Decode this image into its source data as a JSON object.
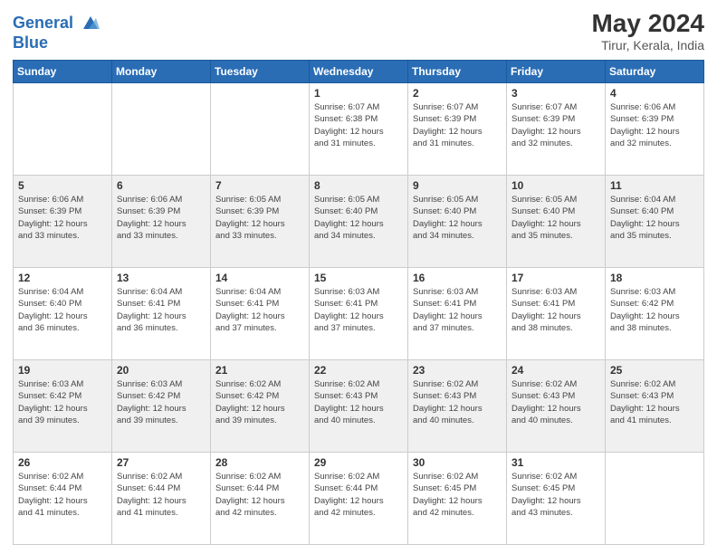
{
  "header": {
    "logo_line1": "General",
    "logo_line2": "Blue",
    "month_year": "May 2024",
    "location": "Tirur, Kerala, India"
  },
  "days_of_week": [
    "Sunday",
    "Monday",
    "Tuesday",
    "Wednesday",
    "Thursday",
    "Friday",
    "Saturday"
  ],
  "weeks": [
    [
      {
        "day": "",
        "info": ""
      },
      {
        "day": "",
        "info": ""
      },
      {
        "day": "",
        "info": ""
      },
      {
        "day": "1",
        "info": "Sunrise: 6:07 AM\nSunset: 6:38 PM\nDaylight: 12 hours\nand 31 minutes."
      },
      {
        "day": "2",
        "info": "Sunrise: 6:07 AM\nSunset: 6:39 PM\nDaylight: 12 hours\nand 31 minutes."
      },
      {
        "day": "3",
        "info": "Sunrise: 6:07 AM\nSunset: 6:39 PM\nDaylight: 12 hours\nand 32 minutes."
      },
      {
        "day": "4",
        "info": "Sunrise: 6:06 AM\nSunset: 6:39 PM\nDaylight: 12 hours\nand 32 minutes."
      }
    ],
    [
      {
        "day": "5",
        "info": "Sunrise: 6:06 AM\nSunset: 6:39 PM\nDaylight: 12 hours\nand 33 minutes."
      },
      {
        "day": "6",
        "info": "Sunrise: 6:06 AM\nSunset: 6:39 PM\nDaylight: 12 hours\nand 33 minutes."
      },
      {
        "day": "7",
        "info": "Sunrise: 6:05 AM\nSunset: 6:39 PM\nDaylight: 12 hours\nand 33 minutes."
      },
      {
        "day": "8",
        "info": "Sunrise: 6:05 AM\nSunset: 6:40 PM\nDaylight: 12 hours\nand 34 minutes."
      },
      {
        "day": "9",
        "info": "Sunrise: 6:05 AM\nSunset: 6:40 PM\nDaylight: 12 hours\nand 34 minutes."
      },
      {
        "day": "10",
        "info": "Sunrise: 6:05 AM\nSunset: 6:40 PM\nDaylight: 12 hours\nand 35 minutes."
      },
      {
        "day": "11",
        "info": "Sunrise: 6:04 AM\nSunset: 6:40 PM\nDaylight: 12 hours\nand 35 minutes."
      }
    ],
    [
      {
        "day": "12",
        "info": "Sunrise: 6:04 AM\nSunset: 6:40 PM\nDaylight: 12 hours\nand 36 minutes."
      },
      {
        "day": "13",
        "info": "Sunrise: 6:04 AM\nSunset: 6:41 PM\nDaylight: 12 hours\nand 36 minutes."
      },
      {
        "day": "14",
        "info": "Sunrise: 6:04 AM\nSunset: 6:41 PM\nDaylight: 12 hours\nand 37 minutes."
      },
      {
        "day": "15",
        "info": "Sunrise: 6:03 AM\nSunset: 6:41 PM\nDaylight: 12 hours\nand 37 minutes."
      },
      {
        "day": "16",
        "info": "Sunrise: 6:03 AM\nSunset: 6:41 PM\nDaylight: 12 hours\nand 37 minutes."
      },
      {
        "day": "17",
        "info": "Sunrise: 6:03 AM\nSunset: 6:41 PM\nDaylight: 12 hours\nand 38 minutes."
      },
      {
        "day": "18",
        "info": "Sunrise: 6:03 AM\nSunset: 6:42 PM\nDaylight: 12 hours\nand 38 minutes."
      }
    ],
    [
      {
        "day": "19",
        "info": "Sunrise: 6:03 AM\nSunset: 6:42 PM\nDaylight: 12 hours\nand 39 minutes."
      },
      {
        "day": "20",
        "info": "Sunrise: 6:03 AM\nSunset: 6:42 PM\nDaylight: 12 hours\nand 39 minutes."
      },
      {
        "day": "21",
        "info": "Sunrise: 6:02 AM\nSunset: 6:42 PM\nDaylight: 12 hours\nand 39 minutes."
      },
      {
        "day": "22",
        "info": "Sunrise: 6:02 AM\nSunset: 6:43 PM\nDaylight: 12 hours\nand 40 minutes."
      },
      {
        "day": "23",
        "info": "Sunrise: 6:02 AM\nSunset: 6:43 PM\nDaylight: 12 hours\nand 40 minutes."
      },
      {
        "day": "24",
        "info": "Sunrise: 6:02 AM\nSunset: 6:43 PM\nDaylight: 12 hours\nand 40 minutes."
      },
      {
        "day": "25",
        "info": "Sunrise: 6:02 AM\nSunset: 6:43 PM\nDaylight: 12 hours\nand 41 minutes."
      }
    ],
    [
      {
        "day": "26",
        "info": "Sunrise: 6:02 AM\nSunset: 6:44 PM\nDaylight: 12 hours\nand 41 minutes."
      },
      {
        "day": "27",
        "info": "Sunrise: 6:02 AM\nSunset: 6:44 PM\nDaylight: 12 hours\nand 41 minutes."
      },
      {
        "day": "28",
        "info": "Sunrise: 6:02 AM\nSunset: 6:44 PM\nDaylight: 12 hours\nand 42 minutes."
      },
      {
        "day": "29",
        "info": "Sunrise: 6:02 AM\nSunset: 6:44 PM\nDaylight: 12 hours\nand 42 minutes."
      },
      {
        "day": "30",
        "info": "Sunrise: 6:02 AM\nSunset: 6:45 PM\nDaylight: 12 hours\nand 42 minutes."
      },
      {
        "day": "31",
        "info": "Sunrise: 6:02 AM\nSunset: 6:45 PM\nDaylight: 12 hours\nand 43 minutes."
      },
      {
        "day": "",
        "info": ""
      }
    ]
  ]
}
